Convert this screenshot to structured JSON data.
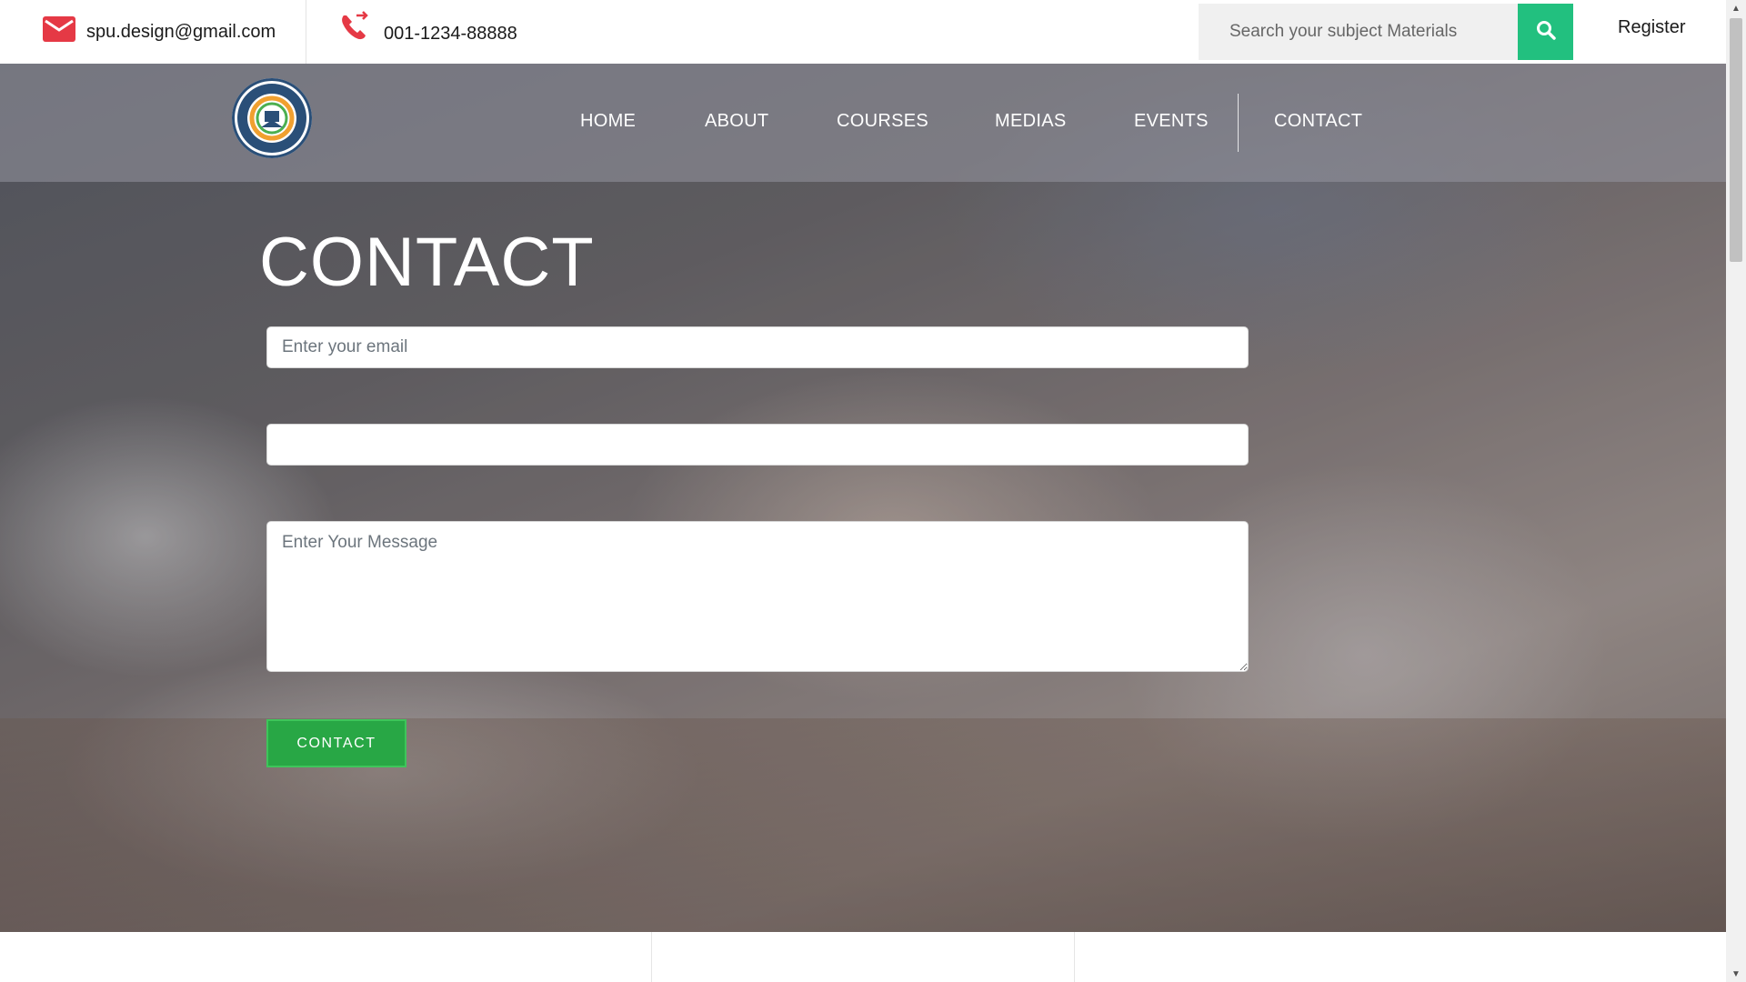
{
  "topbar": {
    "email": "spu.design@gmail.com",
    "phone": "001-1234-88888",
    "search_placeholder": "Search your subject Materials",
    "register_label": "Register"
  },
  "nav": {
    "items": [
      {
        "label": "HOME"
      },
      {
        "label": "ABOUT"
      },
      {
        "label": "COURSES"
      },
      {
        "label": "MEDIAS"
      },
      {
        "label": "EVENTS"
      },
      {
        "label": "CONTACT"
      }
    ]
  },
  "contact": {
    "title": "CONTACT",
    "email_placeholder": "Enter your email",
    "second_placeholder": "",
    "message_placeholder": "Enter Your Message",
    "button_label": "CONTACT"
  },
  "colors": {
    "accent_green": "#22c07f",
    "button_green": "#28a745",
    "icon_red": "#e53945"
  },
  "icons": {
    "email": "mail-icon",
    "phone": "phone-icon",
    "search": "search-icon",
    "logo": "college-logo"
  }
}
